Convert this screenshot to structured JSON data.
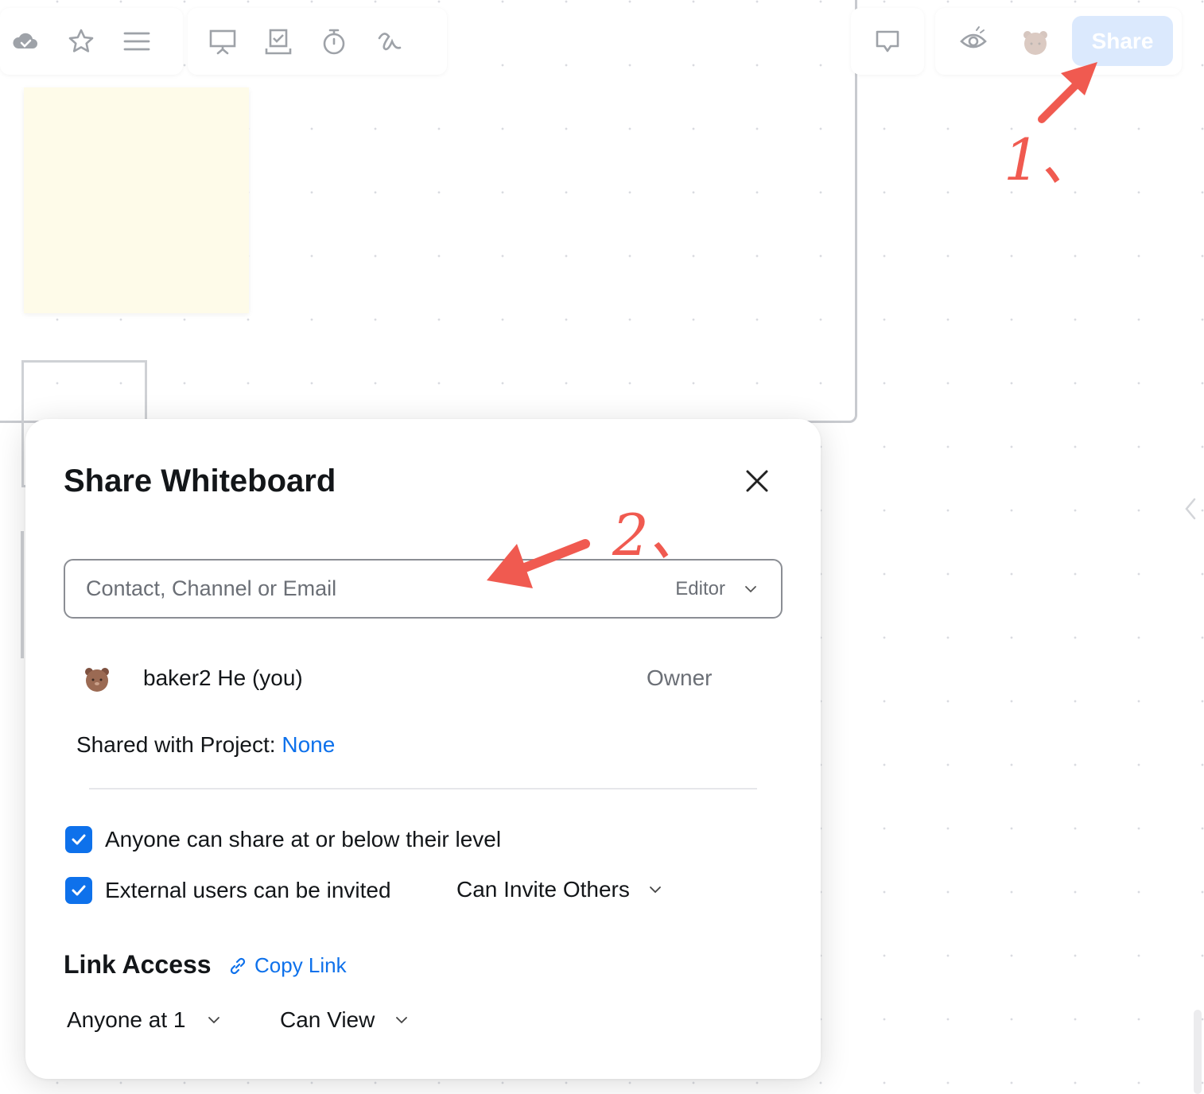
{
  "toolbar": {
    "left_icons": [
      "cloud-check-icon",
      "star-icon",
      "menu-icon"
    ],
    "middle_icons": [
      "present-icon",
      "vote-icon",
      "timer-icon",
      "draw-icon"
    ],
    "right_icons": [
      "comment-icon",
      "eye-icon"
    ],
    "share_label": "Share"
  },
  "modal": {
    "title": "Share Whiteboard",
    "invite": {
      "placeholder": "Contact, Channel or Email",
      "role": "Editor"
    },
    "user": {
      "name": "baker2 He (you)",
      "role": "Owner"
    },
    "project": {
      "label": "Shared with Project: ",
      "value": "None"
    },
    "options": [
      {
        "label": "Anyone can share at or below their level",
        "checked": true
      },
      {
        "label": "External users can be invited",
        "checked": true
      }
    ],
    "invite_permission": "Can Invite Others",
    "link_access": {
      "title": "Link Access",
      "copy_label": "Copy Link",
      "scope": "Anyone at 1",
      "permission": "Can View"
    }
  },
  "annotations": {
    "step1": "1、",
    "step2": "2、",
    "color": "#f05a50"
  },
  "colors": {
    "accent": "#0e71eb",
    "share_button_bg": "#dbe9fd",
    "sticky_note": "#fefbe9"
  }
}
